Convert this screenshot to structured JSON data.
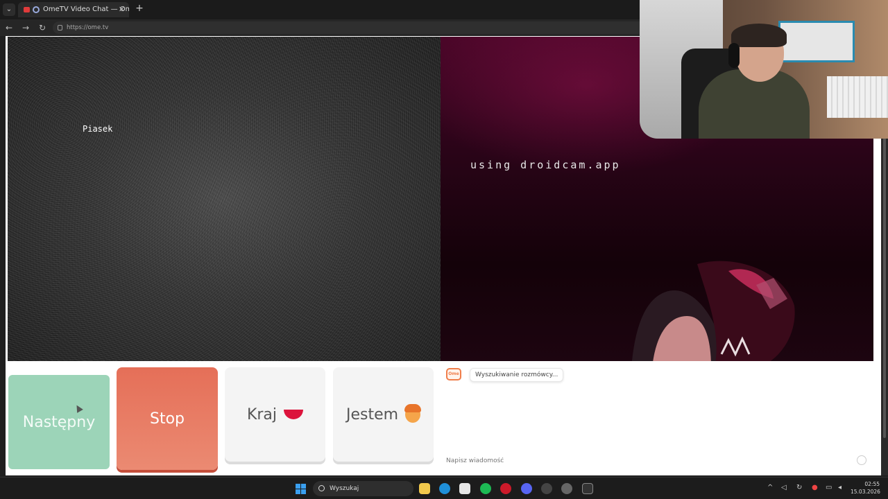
{
  "browser": {
    "tab_title": "OmeTV Video Chat — Omegle",
    "tab_close": "✕",
    "new_tab": "+",
    "url": "https://ome.tv"
  },
  "video": {
    "left_label": "Piasek",
    "right_watermark": "using droidcam.app"
  },
  "controls": {
    "next_label": "Następny",
    "stop_label": "Stop",
    "country_label": "Kraj",
    "gender_label": "Jestem"
  },
  "chat": {
    "logo_text": "Ome",
    "status_message": "Wyszukiwanie rozmówcy...",
    "input_placeholder": "Napisz wiadomość"
  },
  "taskbar": {
    "search_label": "Wyszukaj",
    "time": "02:55",
    "date": "15.03.2026"
  },
  "colors": {
    "next_button": "#9cd4b8",
    "stop_button": "#e56f58",
    "brand_orange": "#f07d4a",
    "windows_blue": "#3a9ff0"
  },
  "icons": {
    "back": "arrow-left-icon",
    "forward": "arrow-right-icon",
    "reload": "reload-icon",
    "country_flag": "flag-icon",
    "gender": "face-icon",
    "emoji": "emoji-icon"
  }
}
